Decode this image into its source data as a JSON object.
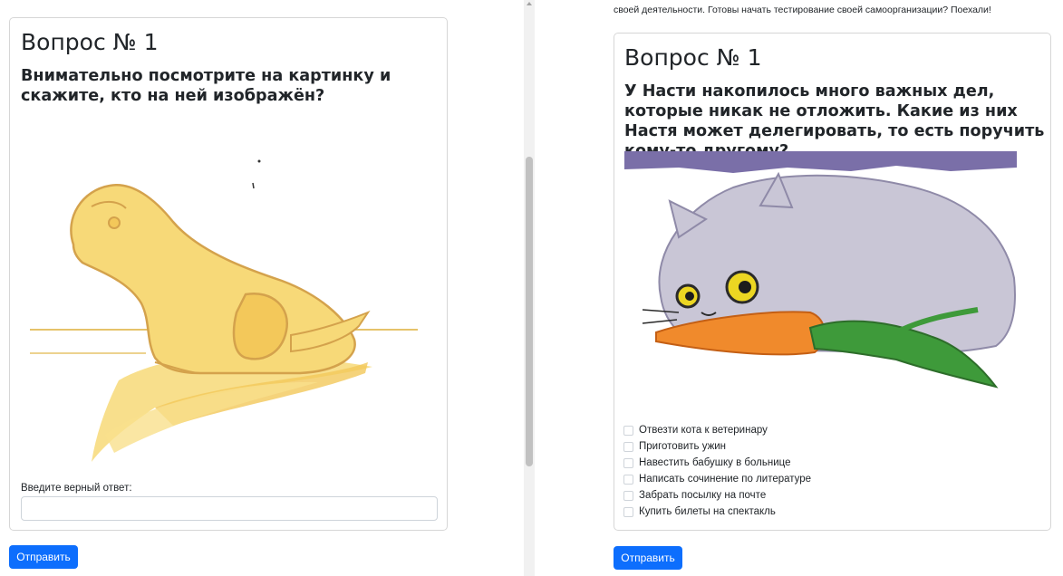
{
  "left": {
    "title": "Вопрос № 1",
    "question": "Внимательно посмотрите на картинку и скажите, кто на ней изображён?",
    "image_alt": "frog-illustration",
    "answer_label": "Введите верный ответ:",
    "answer_value": "",
    "submit_label": "Отправить"
  },
  "right": {
    "intro": "своей деятельности. Готовы начать тестирование своей самоорганизации? Поехали!",
    "title": "Вопрос № 1",
    "question": "У Насти накопилось много важных дел, которые никак не отложить. Какие из них Настя может делегировать, то есть поручить кому-то другому?",
    "image_alt": "cat-with-carrot-illustration",
    "options": [
      "Отвезти кота к ветеринару",
      "Приготовить ужин",
      "Навестить бабушку в больнице",
      "Написать сочинение по литературе",
      "Забрать посылку на почте",
      "Купить билеты на спектакль"
    ],
    "submit_label": "Отправить"
  },
  "colors": {
    "primary": "#0d6efd",
    "border": "#d6d6d6",
    "frog": "#f7d978",
    "frog_outline": "#d4a24c",
    "cat": "#c9c6d6",
    "carrot": "#f08a2c",
    "band": "#7a6fa8"
  }
}
